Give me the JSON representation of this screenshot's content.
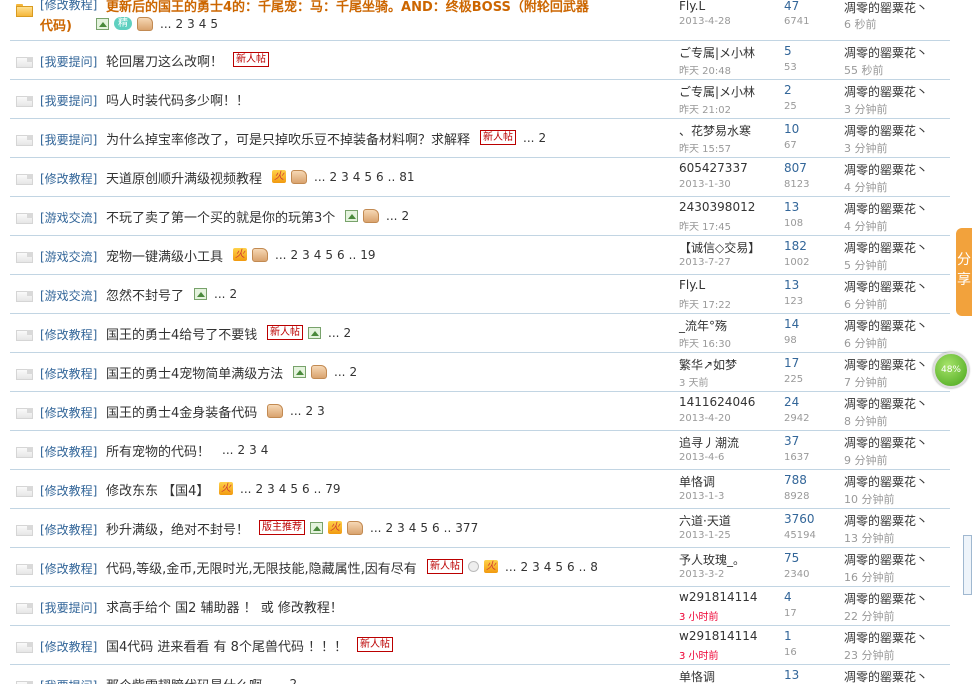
{
  "threads": [
    {
      "category": "[修改教程]",
      "title": "更新后的国王的勇士4的：千尾宠：马：千尾坐骑。AND：终极BOSS（附轮回武器",
      "title2": "代码)",
      "hot": true,
      "icons": [
        "image",
        "jing",
        "thumb"
      ],
      "pages": [
        "...",
        "2",
        "3",
        "4",
        "5"
      ],
      "author": "Fly.L",
      "author_date": "2013-4-28",
      "replies": "47",
      "views": "6741",
      "last_user": "凋零的罂粟花丶",
      "last_time": "6 秒前"
    },
    {
      "category": "[我要提问]",
      "title": "轮回屠刀这么改啊！",
      "icons": [
        "new"
      ],
      "pages": [],
      "author": "ご专属|メ小林",
      "author_date": "昨天 20:48",
      "replies": "5",
      "views": "53",
      "last_user": "凋零的罂粟花丶",
      "last_time": "55 秒前"
    },
    {
      "category": "[我要提问]",
      "title": "吗人时装代码多少啊！！",
      "icons": [],
      "pages": [],
      "author": "ご专属|メ小林",
      "author_date": "昨天 21:02",
      "replies": "2",
      "views": "25",
      "last_user": "凋零的罂粟花丶",
      "last_time": "3 分钟前"
    },
    {
      "category": "[我要提问]",
      "title": "为什么掉宝率修改了，可是只掉吹乐豆不掉装备材料啊？求解释",
      "icons": [
        "new"
      ],
      "pages": [
        "...",
        "2"
      ],
      "author": "、花梦易水寒",
      "author_date": "昨天 15:57",
      "replies": "10",
      "views": "67",
      "last_user": "凋零的罂粟花丶",
      "last_time": "3 分钟前"
    },
    {
      "category": "[修改教程]",
      "title": "天道原创顺升满级视频教程",
      "icons": [
        "fire",
        "thumb"
      ],
      "pages": [
        "...",
        "2",
        "3",
        "4",
        "5",
        "6",
        "..",
        "81"
      ],
      "author": "605427337",
      "author_date": "2013-1-30",
      "replies": "807",
      "views": "8123",
      "last_user": "凋零的罂粟花丶",
      "last_time": "4 分钟前"
    },
    {
      "category": "[游戏交流]",
      "title": "不玩了卖了第一个买的就是你的玩第3个",
      "icons": [
        "image",
        "thumb"
      ],
      "pages": [
        "...",
        "2"
      ],
      "author": "2430398012",
      "author_date": "昨天 17:45",
      "replies": "13",
      "views": "108",
      "last_user": "凋零的罂粟花丶",
      "last_time": "4 分钟前"
    },
    {
      "category": "[游戏交流]",
      "title": "宠物一键满级小工具",
      "icons": [
        "fire",
        "thumb"
      ],
      "pages": [
        "...",
        "2",
        "3",
        "4",
        "5",
        "6",
        "..",
        "19"
      ],
      "author": "【诚信◇交易】",
      "author_date": "2013-7-27",
      "replies": "182",
      "views": "1002",
      "last_user": "凋零的罂粟花丶",
      "last_time": "5 分钟前"
    },
    {
      "category": "[游戏交流]",
      "title": "忽然不封号了",
      "icons": [
        "image"
      ],
      "pages": [
        "...",
        "2"
      ],
      "author": "Fly.L",
      "author_date": "昨天 17:22",
      "replies": "13",
      "views": "123",
      "last_user": "凋零的罂粟花丶",
      "last_time": "6 分钟前"
    },
    {
      "category": "[修改教程]",
      "title": "国王的勇士4给号了不要钱",
      "icons": [
        "new",
        "image"
      ],
      "pages": [
        "...",
        "2"
      ],
      "author": "_流年°殇",
      "author_date": "昨天 16:30",
      "replies": "14",
      "views": "98",
      "last_user": "凋零的罂粟花丶",
      "last_time": "6 分钟前"
    },
    {
      "category": "[修改教程]",
      "title": "国王的勇士4宠物简单满级方法",
      "icons": [
        "image",
        "thumb"
      ],
      "pages": [
        "...",
        "2"
      ],
      "author": "繁华↗如梦",
      "author_date": "3 天前",
      "replies": "17",
      "views": "225",
      "last_user": "凋零的罂粟花丶",
      "last_time": "7 分钟前"
    },
    {
      "category": "[修改教程]",
      "title": "国王的勇士4金身装备代码",
      "icons": [
        "thumb"
      ],
      "pages": [
        "...",
        "2",
        "3"
      ],
      "author": "1411624046",
      "author_date": "2013-4-20",
      "replies": "24",
      "views": "2942",
      "last_user": "凋零的罂粟花丶",
      "last_time": "8 分钟前"
    },
    {
      "category": "[修改教程]",
      "title": "所有宠物的代码！",
      "icons": [],
      "pages": [
        "...",
        "2",
        "3",
        "4"
      ],
      "author": "追寻丿潮流",
      "author_date": "2013-4-6",
      "replies": "37",
      "views": "1637",
      "last_user": "凋零的罂粟花丶",
      "last_time": "9 分钟前"
    },
    {
      "category": "[修改教程]",
      "title": "修改东东  【国4】",
      "icons": [
        "fire"
      ],
      "pages": [
        "...",
        "2",
        "3",
        "4",
        "5",
        "6",
        "..",
        "79"
      ],
      "author": "单恪调",
      "author_date": "2013-1-3",
      "replies": "788",
      "views": "8928",
      "last_user": "凋零的罂粟花丶",
      "last_time": "10 分钟前"
    },
    {
      "category": "[修改教程]",
      "title": "秒升满级，绝对不封号！",
      "icons": [
        "mod",
        "image",
        "fire",
        "thumb"
      ],
      "pages": [
        "...",
        "2",
        "3",
        "4",
        "5",
        "6",
        "..",
        "377"
      ],
      "author": "六道·天道",
      "author_date": "2013-1-25",
      "replies": "3760",
      "views": "45194",
      "last_user": "凋零的罂粟花丶",
      "last_time": "13 分钟前"
    },
    {
      "category": "[修改教程]",
      "title": "代码,等级,金币,无限时光,无限技能,隐藏属性,因有尽有",
      "icons": [
        "new",
        "coin",
        "fire"
      ],
      "pages": [
        "...",
        "2",
        "3",
        "4",
        "5",
        "6",
        "..",
        "8"
      ],
      "author": "予人玫瑰_。",
      "author_date": "2013-3-2",
      "replies": "75",
      "views": "2340",
      "last_user": "凋零的罂粟花丶",
      "last_time": "16 分钟前"
    },
    {
      "category": "[我要提问]",
      "title": "求高手给个 国2 辅助器 ！ 或 修改教程！",
      "icons": [],
      "pages": [],
      "author": "w291814114",
      "author_date": "3 小时前",
      "author_date_new": true,
      "replies": "4",
      "views": "17",
      "last_user": "凋零的罂粟花丶",
      "last_time": "22 分钟前"
    },
    {
      "category": "[修改教程]",
      "title": "国4代码 进来看看 有 8个尾兽代码 ！！！",
      "icons": [
        "new"
      ],
      "pages": [],
      "author": "w291814114",
      "author_date": "3 小时前",
      "author_date_new": true,
      "replies": "1",
      "views": "16",
      "last_user": "凋零的罂粟花丶",
      "last_time": "23 分钟前"
    },
    {
      "category": "[我要提问]",
      "title": "那个紫雷翅膀代码是什么啊",
      "icons": [],
      "pages": [
        "...",
        "2"
      ],
      "author": "单恪调",
      "author_date": "",
      "replies": "13",
      "views": "",
      "last_user": "凋零的罂粟花丶",
      "last_time": ""
    }
  ],
  "badges": {
    "new": "新人帖",
    "jing": "精",
    "fire": "火",
    "mod": "版主推荐"
  },
  "side_tab": "分享",
  "progress": {
    "label": "48%",
    "value": 48
  }
}
